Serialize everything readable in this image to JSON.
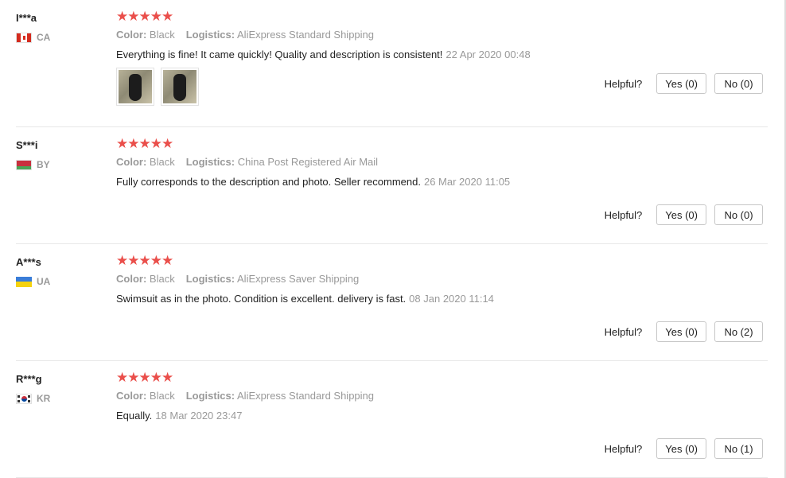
{
  "labels": {
    "color": "Color:",
    "logistics": "Logistics:",
    "helpful": "Helpful?"
  },
  "reviews": [
    {
      "name": "I***a",
      "country": "CA",
      "flag": "canada",
      "color": "Black",
      "logistics": "AliExpress Standard Shipping",
      "text": "Everything is fine! It came quickly! Quality and description is consistent!",
      "date": "22 Apr 2020 00:48",
      "photos": 2,
      "yes": "Yes (0)",
      "no": "No (0)"
    },
    {
      "name": "S***i",
      "country": "BY",
      "flag": "belarus",
      "color": "Black",
      "logistics": "China Post Registered Air Mail",
      "text": "Fully corresponds to the description and photo. Seller recommend.",
      "date": "26 Mar 2020 11:05",
      "photos": 0,
      "yes": "Yes (0)",
      "no": "No (0)"
    },
    {
      "name": "A***s",
      "country": "UA",
      "flag": "ukraine",
      "color": "Black",
      "logistics": "AliExpress Saver Shipping",
      "text": "Swimsuit as in the photo. Condition is excellent. delivery is fast.",
      "date": "08 Jan 2020 11:14",
      "photos": 0,
      "yes": "Yes (0)",
      "no": "No (2)"
    },
    {
      "name": "R***g",
      "country": "KR",
      "flag": "korea",
      "color": "Black",
      "logistics": "AliExpress Standard Shipping",
      "text": "Equally.",
      "date": "18 Mar 2020 23:47",
      "photos": 0,
      "yes": "Yes (0)",
      "no": "No (1)"
    }
  ],
  "colors": {
    "star": "#ea4f4b",
    "muted": "#999999",
    "border": "#e8e8e8"
  }
}
